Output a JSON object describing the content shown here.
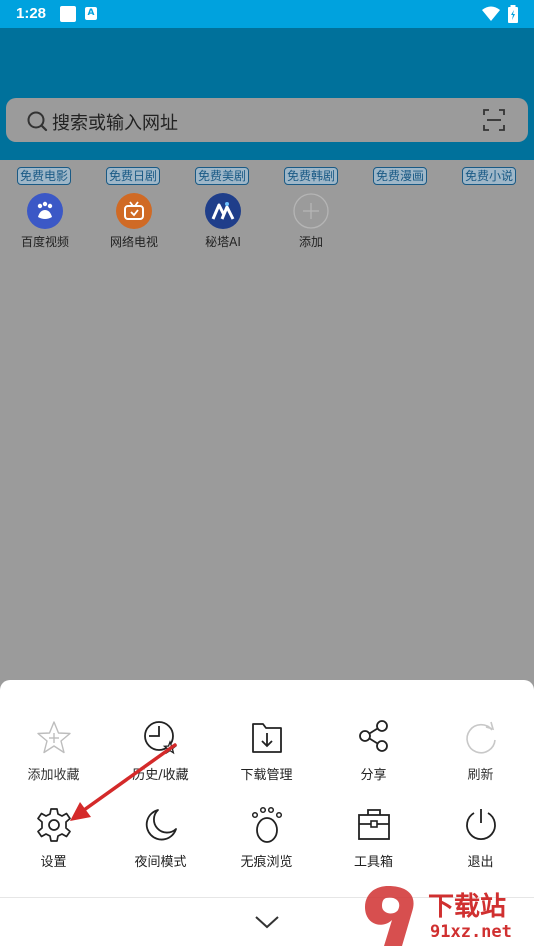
{
  "status_bar": {
    "time": "1:28",
    "badge": "A"
  },
  "search": {
    "placeholder": "搜索或输入网址"
  },
  "quick_tags": [
    "免费电影",
    "免费日剧",
    "免费美剧",
    "免费韩剧",
    "免费漫画",
    "免费小说"
  ],
  "shortcuts": [
    {
      "label": "百度视频",
      "icon": "baidu-paw-icon",
      "color": "#3b58c6"
    },
    {
      "label": "网络电视",
      "icon": "tv-icon",
      "color": "#d06a25"
    },
    {
      "label": "秘塔AI",
      "icon": "metaso-icon",
      "color": "#1f3e8a"
    },
    {
      "label": "添加",
      "icon": "plus-circle-icon",
      "color": "#b0b0b0"
    }
  ],
  "menu": {
    "row1": [
      {
        "label": "添加收藏",
        "icon": "star-plus-icon",
        "enabled": false
      },
      {
        "label": "历史/收藏",
        "icon": "clock-star-icon",
        "enabled": true
      },
      {
        "label": "下载管理",
        "icon": "download-folder-icon",
        "enabled": true
      },
      {
        "label": "分享",
        "icon": "share-icon",
        "enabled": true
      },
      {
        "label": "刷新",
        "icon": "refresh-icon",
        "enabled": false
      }
    ],
    "row2": [
      {
        "label": "设置",
        "icon": "gear-icon",
        "enabled": true
      },
      {
        "label": "夜间模式",
        "icon": "moon-icon",
        "enabled": true
      },
      {
        "label": "无痕浏览",
        "icon": "paw-icon",
        "enabled": true
      },
      {
        "label": "工具箱",
        "icon": "toolbox-icon",
        "enabled": true
      },
      {
        "label": "退出",
        "icon": "power-icon",
        "enabled": true
      }
    ]
  },
  "watermark": {
    "brand": "下载站",
    "domain": "91xz.net"
  },
  "colors": {
    "status_bar": "#00a2de",
    "header": "#00719b",
    "overlay": "#9b9b9b",
    "annotation_arrow": "#d42a2a"
  }
}
